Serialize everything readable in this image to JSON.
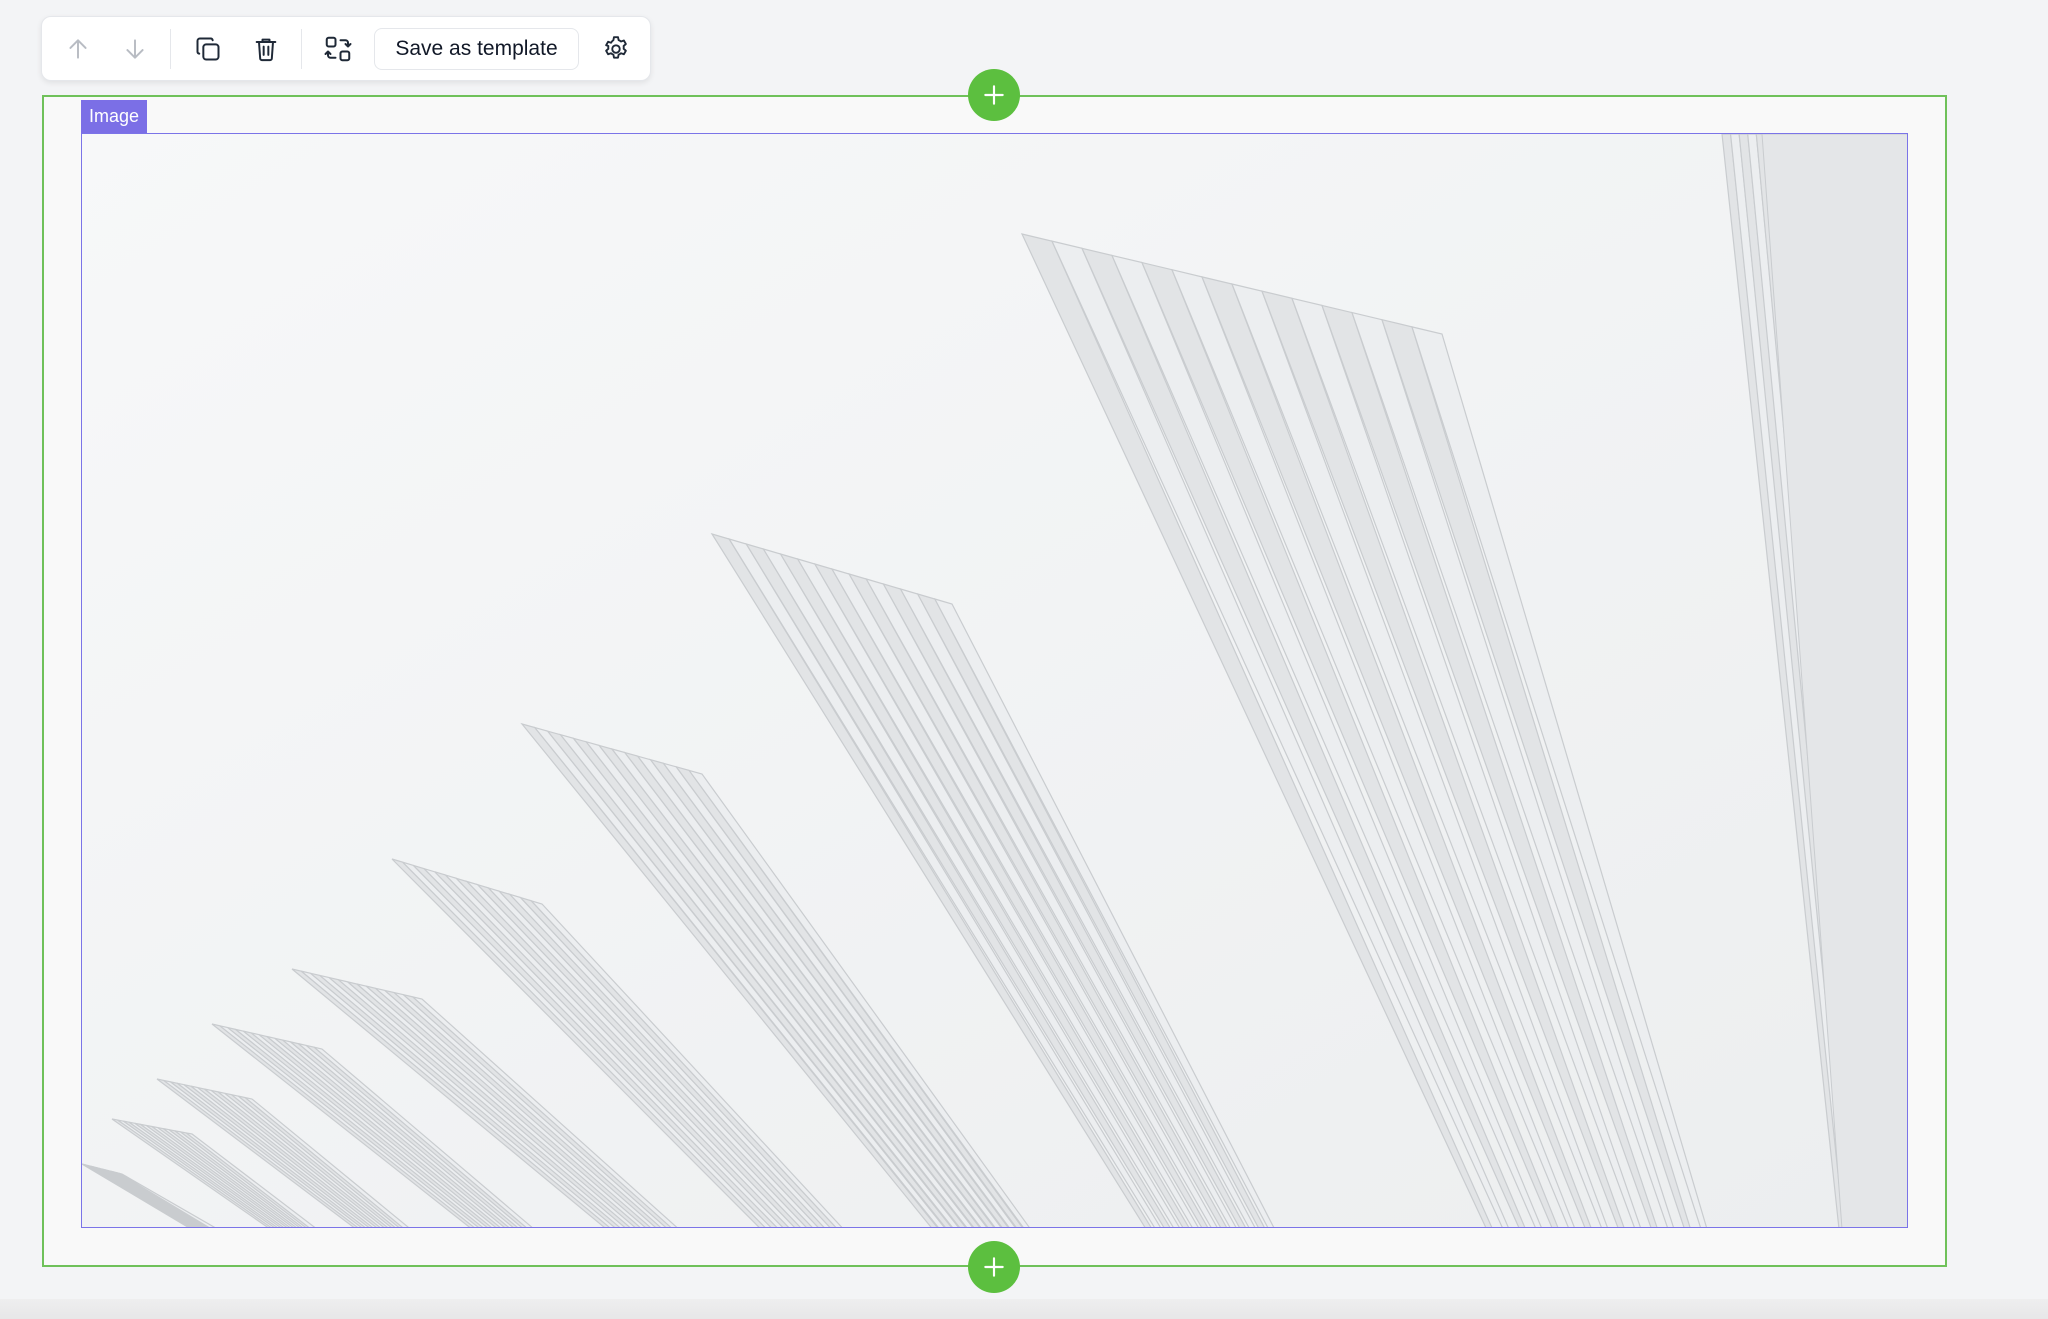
{
  "toolbar": {
    "move_up_icon": "arrow-up-icon",
    "move_down_icon": "arrow-down-icon",
    "duplicate_icon": "copy-icon",
    "delete_icon": "trash-icon",
    "swap_icon": "swap-blocks-icon",
    "save_template_label": "Save as template",
    "settings_icon": "gear-icon"
  },
  "block": {
    "type_label": "Image",
    "image_subject": "white-fan-architecture-photo"
  },
  "colors": {
    "section_outline": "#6fc15a",
    "add_button": "#5cbf3f",
    "image_outline": "#7b74e8",
    "label_background": "#7b6fe6"
  },
  "add_buttons": {
    "top_icon": "plus-icon",
    "bottom_icon": "plus-icon"
  }
}
